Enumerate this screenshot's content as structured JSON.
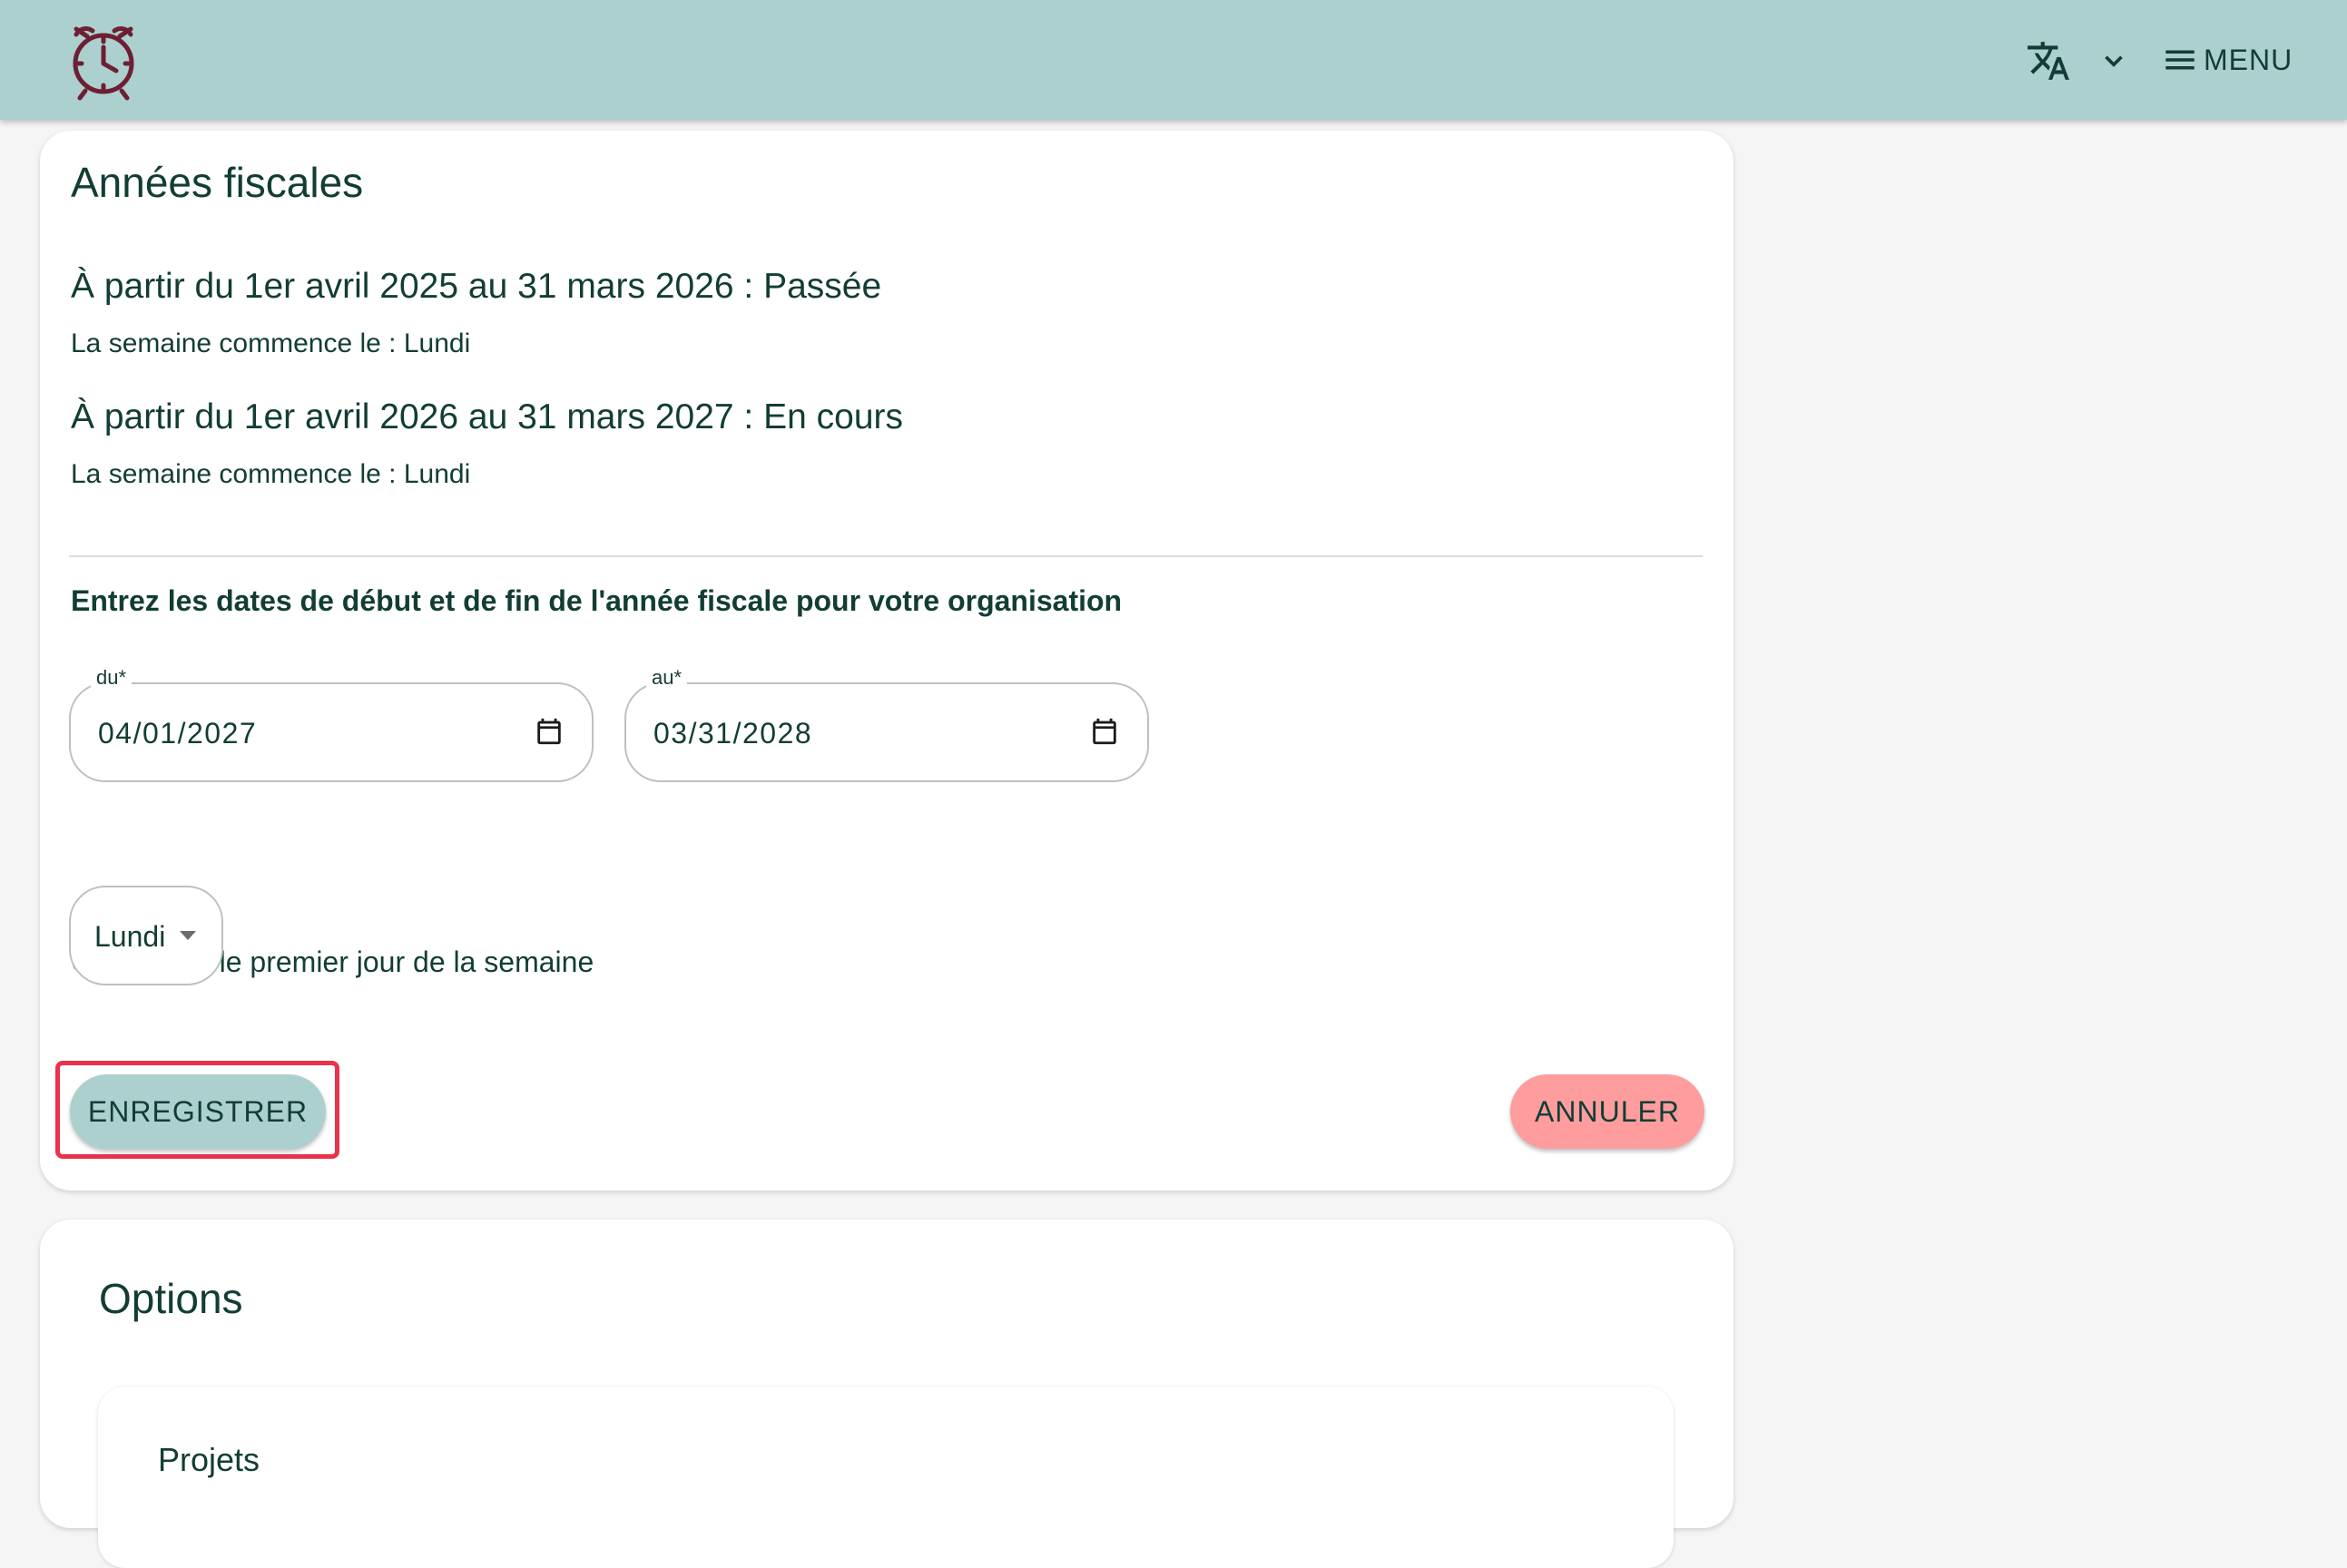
{
  "header": {
    "logo_icon": "alarm-clock-icon",
    "translate_icon": "translate-icon",
    "language_caret_icon": "chevron-down-icon",
    "menu_icon": "hamburger-icon",
    "menu_label": "MENU",
    "background_color": "#acd0cd"
  },
  "fiscal_card": {
    "title": "Années fiscales",
    "years": [
      {
        "period": "À partir du 1er avril 2025 au 31 mars 2026 : Passée",
        "week_start": "La semaine commence le : Lundi"
      },
      {
        "period": "À partir du 1er avril 2026 au 31 mars 2027 : En cours",
        "week_start": "La semaine commence le : Lundi"
      }
    ],
    "instruction": "Entrez les dates de début et de fin de l'année fiscale pour votre organisation",
    "from_field": {
      "label": "du*",
      "value": "04/01/2027",
      "icon": "calendar-icon"
    },
    "to_field": {
      "label": "au*",
      "value": "03/31/2028",
      "icon": "calendar-icon"
    },
    "weekday_label": "Choisissez le premier jour de la semaine",
    "weekday_select": {
      "value": "Lundi",
      "icon": "caret-down-icon"
    },
    "save_label": "ENREGISTRER",
    "cancel_label": "ANNULER",
    "save_color": "#acd0cd",
    "cancel_color": "#ff9c9e",
    "highlight_color": "#e8334a"
  },
  "options_card": {
    "title": "Options",
    "section_title": "Projets"
  }
}
